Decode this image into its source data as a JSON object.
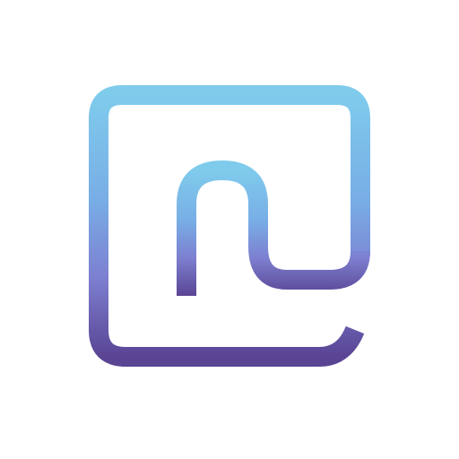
{
  "icon": {
    "name": "app-logo-icon",
    "shape": "rounded-square-outline-with-n-shaped-curve",
    "colors": {
      "top": "#7fcbec",
      "upper_mid": "#78aee6",
      "lower_mid": "#7d7fd0",
      "bottom": "#5a4494",
      "background": "#ffffff"
    }
  }
}
